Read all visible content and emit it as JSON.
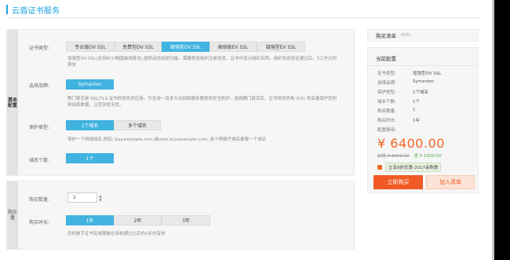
{
  "page": {
    "title": "云盾证书服务"
  },
  "basic_section": {
    "tab_label": "基本配置",
    "cert_type": {
      "label": "证书类型:",
      "options": [
        "专业版OV SSL",
        "免费型DV SSL",
        "增强型OV SSL",
        "高级版EV SSL",
        "增强型EV SSL"
      ],
      "selected_index": 2,
      "description": "增强型OV SSL(支持ECC椭圆曲线算法),提供动态加密功能。需要核验组织注册信息，证书中显示组织名称。组织信息验证通过后，3工作日内颁发"
    },
    "brand": {
      "label": "选择品牌:",
      "option": "Symantec",
      "description": "赛门铁克是 SSL/TLS 证书的领先供应商。为全球一百多万台网络服务器提供安全防护。选择赛门铁克后，证书颁发机构 (CA) 将妥善保护您的网站和数据，让您安枕无忧。"
    },
    "protect_type": {
      "label": "保护类型:",
      "options": [
        "1个域名",
        "多个域名"
      ],
      "selected_index": 0,
      "description": "保护一个明细域名,例如: buy.example.com,或next.buy.example.com, 各个明细子域名都算一个域名"
    },
    "domain_count": {
      "label": "域名个数:",
      "value": "1个"
    }
  },
  "buy_section": {
    "tab_label": "购买量",
    "quantity": {
      "label": "购买数量:",
      "value": "1"
    },
    "duration": {
      "label": "购买时长:",
      "options": [
        "1年",
        "2年",
        "3年"
      ],
      "selected_index": 0,
      "description": "您的数字证书有效期是在审核通过之后的1年内有效"
    }
  },
  "cart": {
    "title": "购买清单",
    "count": "0(0)"
  },
  "config": {
    "title": "当前配置",
    "rows": [
      {
        "k": "证书类型:",
        "v": "增强型OV SSL"
      },
      {
        "k": "选择品牌:",
        "v": "Symantec"
      },
      {
        "k": "保护类型:",
        "v": "1个域名"
      },
      {
        "k": "域名个数:",
        "v": "1个"
      },
      {
        "k": "购买数量:",
        "v": "1"
      },
      {
        "k": "购买时长:",
        "v": "1年"
      },
      {
        "k": "配置费用:",
        "v": ""
      }
    ],
    "price": "¥ 6400.00",
    "original_price": "价格 ¥ 8000.00",
    "save": "省 ¥ 1600.00",
    "promo": "立享8折优惠-2017采购季"
  },
  "actions": {
    "buy": "立即购买",
    "add_cart": "加入清单"
  },
  "colors": {
    "accent": "#1ba1e2",
    "active_option": "#40b3e0",
    "price": "#f26522",
    "buy_button": "#f15a24"
  }
}
